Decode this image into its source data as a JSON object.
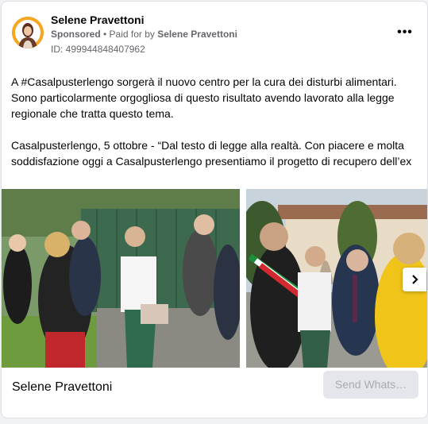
{
  "post": {
    "author": "Selene Pravettoni",
    "sponsored": "Sponsored",
    "paid_prefix": " • Paid for by ",
    "paid_by": "Selene Pravettoni",
    "ad_id": "ID: 499944848407962",
    "more_label": "•••",
    "text_1": "A #Casalpusterlengo sorgerà il nuovo centro per la cura dei disturbi alimentari. Sono particolarmente orgogliosa di questo risultato avendo lavorato alla legge regionale che tratta questo tema.",
    "text_2": "Casalpusterlengo, 5 ottobre - “Dal testo di legge alla realtà. Con piacere e molta soddisfazione oggi a Casalpusterlengo presentiamo il progetto di recupero dell’ex ospedale Enzo e Rosy Rossi che diventerà un centro per la cura dei disturbi della…"
  },
  "footer": {
    "page_name": "Selene Pravettoni",
    "cta_label": "Send Whats…"
  },
  "icons": {
    "more": "more-icon",
    "next": "chevron-right-icon"
  }
}
